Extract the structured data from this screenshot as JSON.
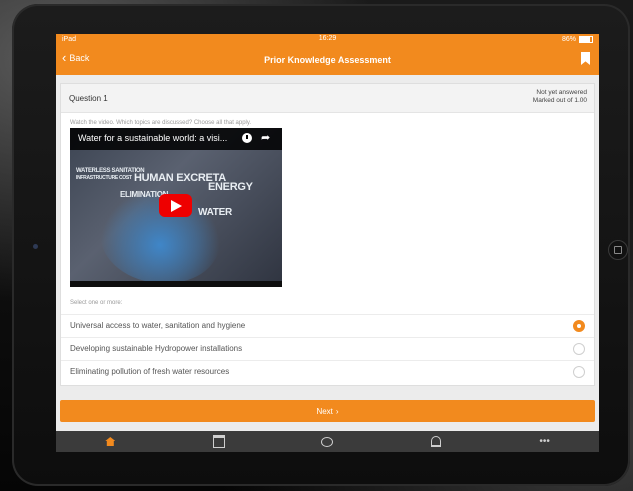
{
  "statusbar": {
    "carrier": "iPad",
    "time": "16:29",
    "battery": "86%"
  },
  "navbar": {
    "back_label": "Back",
    "title": "Prior Knowledge Assessment"
  },
  "question": {
    "title": "Question 1",
    "status": "Not yet answered",
    "marks": "Marked out of 1.00",
    "prompt": "Watch the video. Which topics are discussed? Choose all that apply."
  },
  "video": {
    "title": "Water for a sustainable world: a visi...",
    "words": [
      "WATERLESS SANITATION",
      "INFRASTRUCTURE COST",
      "HUMAN EXCRETA",
      "ENERGY",
      "ELIMINATION",
      "WATER"
    ]
  },
  "answers": {
    "hint": "Select one or more:",
    "options": [
      {
        "label": "Universal access to water, sanitation and hygiene",
        "selected": true
      },
      {
        "label": "Developing sustainable Hydropower installations",
        "selected": false
      },
      {
        "label": "Eliminating pollution of fresh water resources",
        "selected": false
      }
    ]
  },
  "next_label": "Next",
  "tabs": [
    {
      "icon": "home-icon",
      "active": true
    },
    {
      "icon": "calendar-icon",
      "active": false
    },
    {
      "icon": "chat-icon",
      "active": false
    },
    {
      "icon": "bell-icon",
      "active": false
    },
    {
      "icon": "more-icon",
      "active": false,
      "label": "•••"
    }
  ],
  "colors": {
    "accent": "#f28a1e",
    "tabbar": "#3b3b3b",
    "background": "#ececec"
  }
}
